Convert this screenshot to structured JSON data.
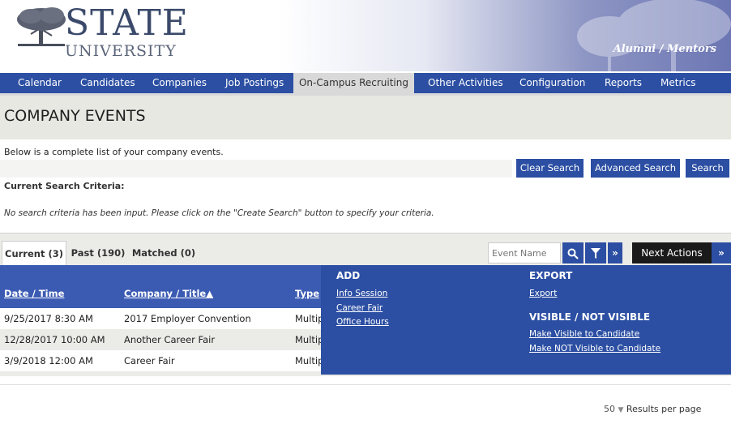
{
  "header": {
    "logo_main": "STATE",
    "logo_sub": "UNIVERSITY",
    "portal_label": "Alumni / Mentors"
  },
  "nav": {
    "items": [
      {
        "label": "Calendar"
      },
      {
        "label": "Candidates"
      },
      {
        "label": "Companies"
      },
      {
        "label": "Job Postings"
      },
      {
        "label": "On-Campus Recruiting",
        "active": true
      },
      {
        "label": "Other Activities"
      },
      {
        "label": "Configuration"
      },
      {
        "label": "Reports"
      },
      {
        "label": "Metrics"
      }
    ]
  },
  "page": {
    "title": "COMPANY EVENTS",
    "intro": "Below is a complete list of your company events.",
    "criteria_label": "Current Search Criteria:",
    "criteria_text": "No search criteria has been input. Please click on the \"Create Search\" button to specify your criteria."
  },
  "buttons": {
    "clear_search": "Clear Search",
    "advanced_search": "Advanced Search",
    "search": "Search"
  },
  "tabs": [
    {
      "label": "Current (3)",
      "active": true
    },
    {
      "label": "Past (190)"
    },
    {
      "label": "Matched (0)"
    }
  ],
  "toolbar": {
    "event_name_placeholder": "Event Name",
    "next_actions": "Next Actions",
    "expand_glyph": "»",
    "next_glyph": "»"
  },
  "table": {
    "headers": [
      "Date / Time",
      "Company / Title▲",
      "Type"
    ],
    "rows": [
      {
        "date": "9/25/2017 8:30 AM",
        "title": "2017 Employer Convention",
        "type": "Multip"
      },
      {
        "date": "12/28/2017 10:00 AM",
        "title": "Another Career Fair",
        "type": "Multip"
      },
      {
        "date": "3/9/2018 12:00 AM",
        "title": "Career Fair",
        "type": "Multip"
      }
    ]
  },
  "pagination": {
    "per_page_value": "50",
    "per_page_label": "Results per page"
  },
  "dropdown": {
    "add_heading": "ADD",
    "add_items": [
      "Info Session",
      "Career Fair",
      "Office Hours"
    ],
    "export_heading": "EXPORT",
    "export_items": [
      "Export"
    ],
    "visible_heading": "VISIBLE / NOT VISIBLE",
    "visible_items": [
      "Make Visible to Candidate",
      "Make NOT Visible to Candidate"
    ]
  },
  "colors": {
    "nav_blue": "#2c4fa3",
    "header_blue": "#3b5bb3",
    "band_gray": "#e8e8e3"
  }
}
